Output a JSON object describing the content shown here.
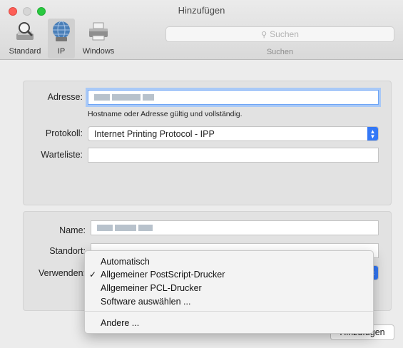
{
  "window": {
    "title": "Hinzufügen"
  },
  "toolbar": {
    "items": [
      {
        "label": "Standard",
        "icon": "standard-printer-icon"
      },
      {
        "label": "IP",
        "icon": "globe-icon"
      },
      {
        "label": "Windows",
        "icon": "windows-printer-icon"
      }
    ],
    "search_placeholder": "Suchen",
    "search_caption": "Suchen",
    "selected": "IP"
  },
  "form": {
    "address_label": "Adresse:",
    "address_hint": "Hostname oder Adresse gültig und vollständig.",
    "protocol_label": "Protokoll:",
    "protocol_value": "Internet Printing Protocol - IPP",
    "queue_label": "Warteliste:",
    "queue_value": "",
    "name_label": "Name:",
    "location_label": "Standort:",
    "use_label": "Verwenden:"
  },
  "use_menu": {
    "items": [
      {
        "label": "Automatisch",
        "checked": false
      },
      {
        "label": "Allgemeiner PostScript-Drucker",
        "checked": true
      },
      {
        "label": "Allgemeiner PCL-Drucker",
        "checked": false
      },
      {
        "label": "Software auswählen ...",
        "checked": false
      },
      {
        "label": "Andere ...",
        "checked": false
      }
    ],
    "check_glyph": "✓"
  },
  "buttons": {
    "add_label": "Hinzufügen"
  },
  "colors": {
    "accent": "#3478f6",
    "focus_ring": "#a9c9f7"
  }
}
